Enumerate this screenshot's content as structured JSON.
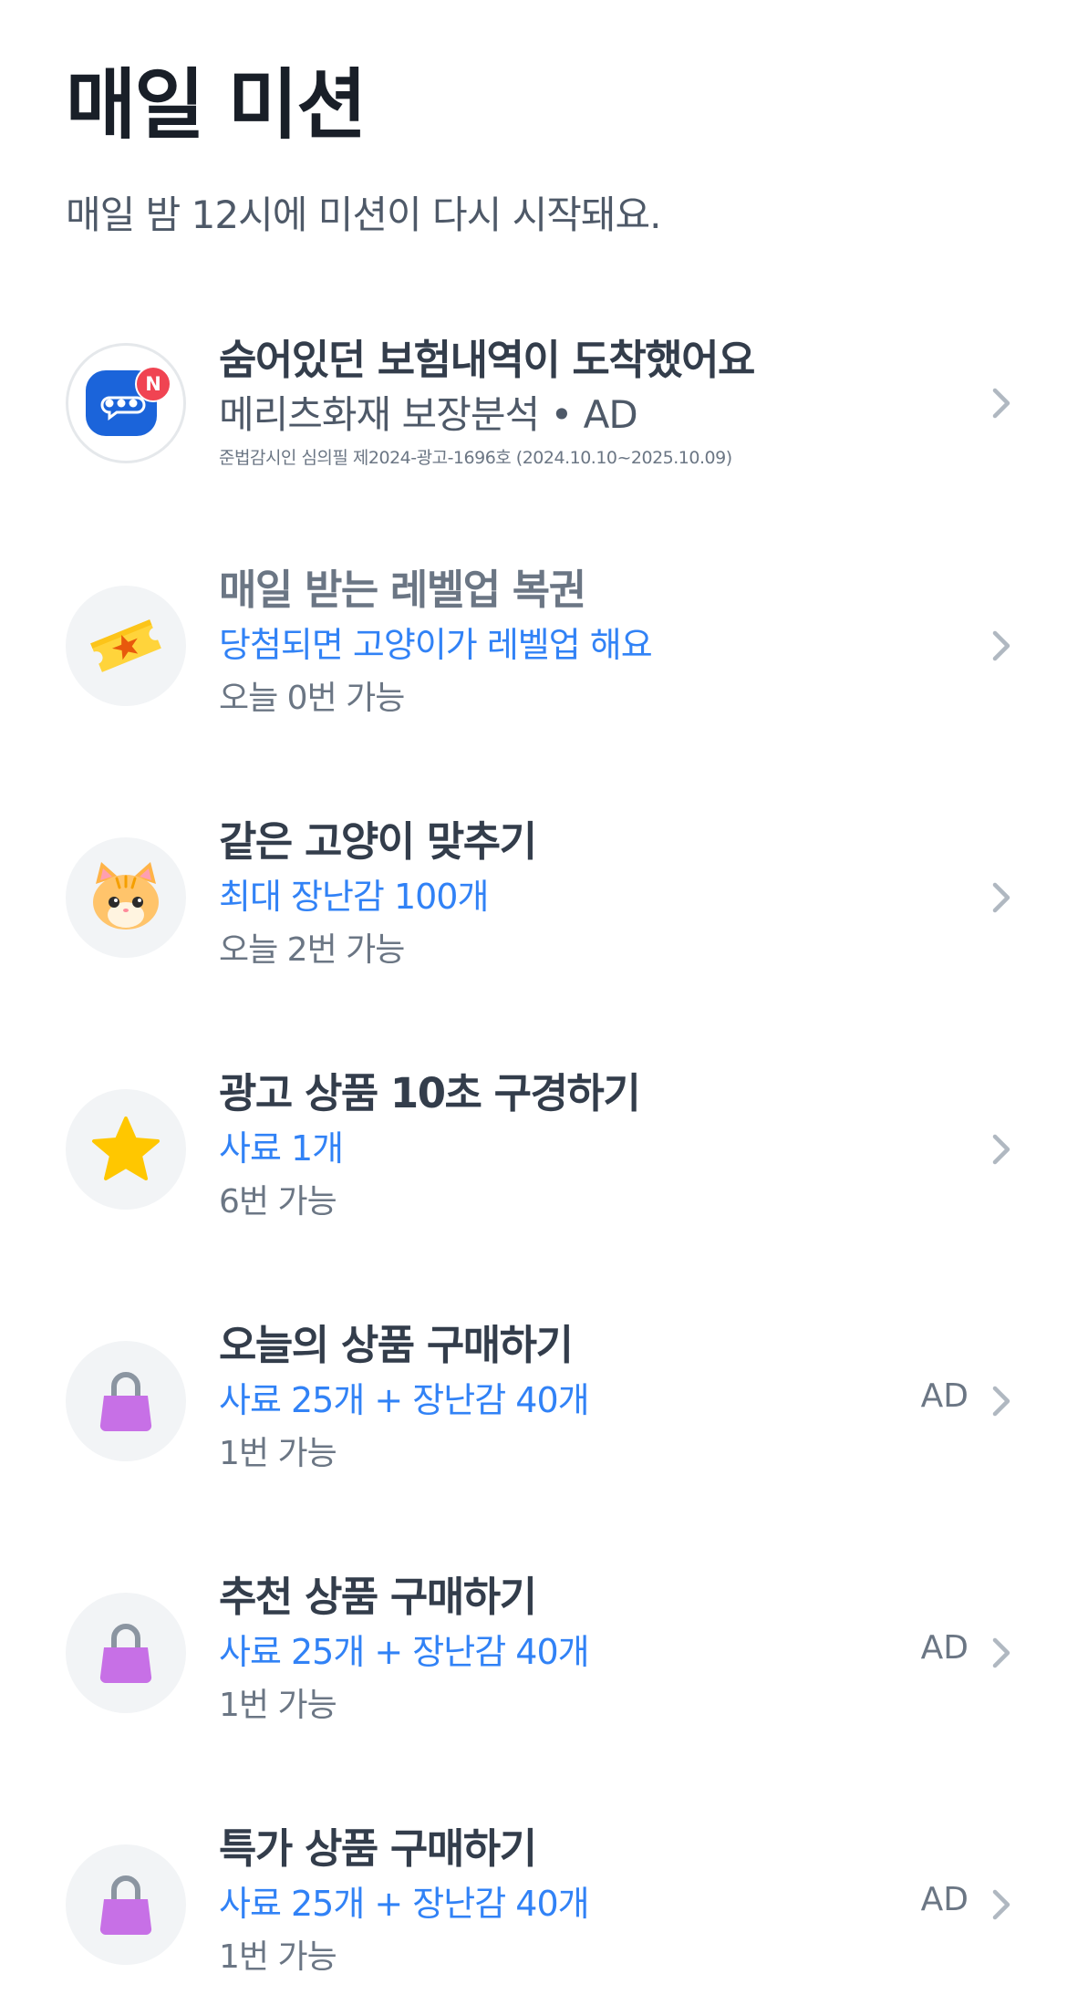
{
  "header": {
    "title": "매일 미션",
    "subtitle": "매일 밤 12시에 미션이 다시 시작돼요."
  },
  "missions": [
    {
      "title": "숨어있던 보험내역이 도착했어요",
      "subtitle": "메리츠화재 보장분석 • AD",
      "note": "준법감시인 심의필 제2024-광고-1696호 (2024.10.10~2025.10.09)",
      "icon": "chat-bubble-icon",
      "badge": "N"
    },
    {
      "title": "매일 받는 레벨업 복권",
      "subtitle": "당첨되면 고양이가 레벨업 해요",
      "count": "오늘 0번 가능",
      "icon": "lottery-ticket-icon"
    },
    {
      "title": "같은 고양이 맞추기",
      "subtitle": "최대 장난감 100개",
      "count": "오늘 2번 가능",
      "icon": "cat-face-icon"
    },
    {
      "title": "광고 상품 10초 구경하기",
      "subtitle": "사료 1개",
      "count": "6번 가능",
      "icon": "star-icon"
    },
    {
      "title": "오늘의 상품 구매하기",
      "subtitle": "사료 25개 + 장난감 40개",
      "count": "1번 가능",
      "ad": "AD",
      "icon": "shopping-bag-icon"
    },
    {
      "title": "추천 상품 구매하기",
      "subtitle": "사료 25개 + 장난감 40개",
      "count": "1번 가능",
      "ad": "AD",
      "icon": "shopping-bag-icon"
    },
    {
      "title": "특가 상품 구매하기",
      "subtitle": "사료 25개 + 장난감 40개",
      "count": "1번 가능",
      "ad": "AD",
      "icon": "shopping-bag-icon"
    }
  ],
  "colors": {
    "accent": "#3182f6",
    "title_dark": "#191f28",
    "text_primary": "#333d4b",
    "text_secondary": "#6b7684",
    "icon_bg": "#f2f4f6",
    "chevron": "#b0b8c1",
    "badge_red": "#f04452",
    "bag_purple": "#c770e6",
    "star_yellow": "#ffc700"
  }
}
